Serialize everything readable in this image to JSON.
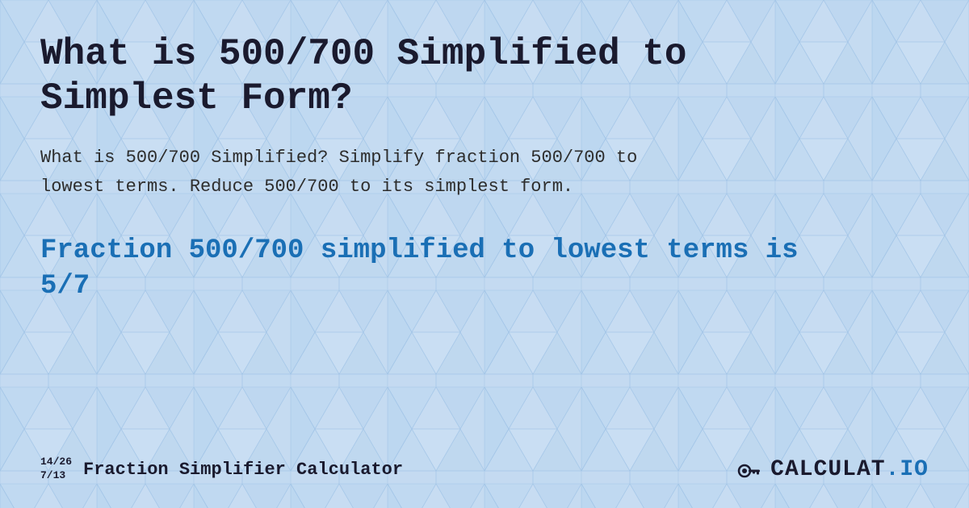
{
  "page": {
    "title": "What is 500/700 Simplified to Simplest Form?",
    "description": "What is 500/700 Simplified? Simplify fraction 500/700 to lowest terms. Reduce 500/700 to its simplest form.",
    "result": "Fraction 500/700 simplified to lowest terms is 5/7",
    "background_color": "#d6e8f7"
  },
  "footer": {
    "fraction_top": "14/26",
    "fraction_bottom": "7/13",
    "site_name": "Fraction Simplifier Calculator",
    "logo_text_main": "CALCULAT",
    "logo_text_suffix": ".IO"
  }
}
